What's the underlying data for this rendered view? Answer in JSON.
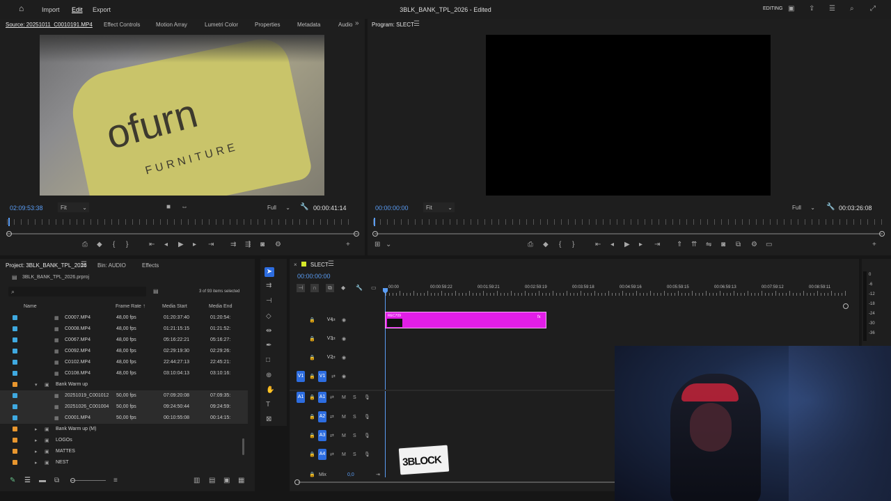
{
  "topbar": {
    "menu": [
      "Import",
      "Edit",
      "Export"
    ],
    "title": "3BLK_BANK_TPL_2026 - Edited",
    "workspace": "EDITING"
  },
  "source_panel": {
    "tabs": [
      "Source: 20251011_C0010191.MP4",
      "Effect Controls",
      "Motion Array",
      "Lumetri Color",
      "Properties",
      "Metadata",
      "Audio"
    ],
    "timecode": "02:09:53:38",
    "fit": "Fit",
    "quality": "Full",
    "duration": "00:00:41:14",
    "video_text": "ofurn",
    "video_subtext": "FURNITURE"
  },
  "program_panel": {
    "title": "Program: SLECT",
    "timecode": "00:00:00:00",
    "fit": "Fit",
    "quality": "Full",
    "duration": "00:03:26:08"
  },
  "project_panel": {
    "tabs": [
      "Project: 3BLK_BANK_TPL_2026",
      "Bin: AUDIO",
      "Effects"
    ],
    "project_file": "3BLK_BANK_TPL_2026.prproj",
    "selection": "3 of 93 items selected",
    "columns": [
      "Name",
      "Frame Rate",
      "Media Start",
      "Media End"
    ],
    "rows": [
      {
        "name": "C0007.MP4",
        "fps": "48,00 fps",
        "start": "01:20:37:40",
        "end": "01:20:54:",
        "color": "#3fa9e0",
        "selected": false
      },
      {
        "name": "C0008.MP4",
        "fps": "48,00 fps",
        "start": "01:21:15:15",
        "end": "01:21:52:",
        "color": "#3fa9e0",
        "selected": false
      },
      {
        "name": "C0067.MP4",
        "fps": "48,00 fps",
        "start": "05:16:22:21",
        "end": "05:16:27:",
        "color": "#3fa9e0",
        "selected": false
      },
      {
        "name": "C0092.MP4",
        "fps": "48,00 fps",
        "start": "02:29:19:30",
        "end": "02:29:26:",
        "color": "#3fa9e0",
        "selected": false
      },
      {
        "name": "C0102.MP4",
        "fps": "48,00 fps",
        "start": "22:44:27:13",
        "end": "22:45:21:",
        "color": "#3fa9e0",
        "selected": false
      },
      {
        "name": "C0108.MP4",
        "fps": "48,00 fps",
        "start": "03:10:04:13",
        "end": "03:10:16:",
        "color": "#3fa9e0",
        "selected": false
      },
      {
        "name": "Bank Warm up",
        "fps": "",
        "start": "",
        "end": "",
        "color": "#e8962e",
        "selected": false,
        "folder": true
      },
      {
        "name": "20251019_C001012",
        "fps": "50,00 fps",
        "start": "07:09:20:08",
        "end": "07:09:35:",
        "color": "#3fa9e0",
        "selected": true
      },
      {
        "name": "20251026_C001004",
        "fps": "50,00 fps",
        "start": "09:24:50:44",
        "end": "09:24:59:",
        "color": "#3fa9e0",
        "selected": true
      },
      {
        "name": "C0001.MP4",
        "fps": "50,00 fps",
        "start": "00:10:55:08",
        "end": "00:14:15:",
        "color": "#3fa9e0",
        "selected": true
      },
      {
        "name": "Bank Warm up (M)",
        "fps": "",
        "start": "",
        "end": "",
        "color": "#e8962e",
        "selected": false,
        "folder": true
      },
      {
        "name": "LOGOs",
        "fps": "",
        "start": "",
        "end": "",
        "color": "#e8962e",
        "selected": false,
        "folder": true
      },
      {
        "name": "MATTES",
        "fps": "",
        "start": "",
        "end": "",
        "color": "#e8962e",
        "selected": false,
        "folder": true
      },
      {
        "name": "NEST",
        "fps": "",
        "start": "",
        "end": "",
        "color": "#e8962e",
        "selected": false,
        "folder": true
      }
    ]
  },
  "timeline": {
    "title": "SLECT",
    "timecode": "00:00:00:00",
    "ruler": [
      "00:00",
      "00:00:59:22",
      "00:01:59:21",
      "00:02:59:19",
      "00:03:59:18",
      "00:04:59:16",
      "00:05:59:15",
      "00:06:59:13",
      "00:07:59:12",
      "00:08:59:11"
    ],
    "tracks": [
      "V4",
      "V3",
      "V2",
      "V1",
      "A1",
      "A2",
      "A3",
      "A4"
    ],
    "mix_label": "Mix",
    "mix_value": "0,0",
    "clip_label": "REC709",
    "clip_color": "#e21ee8",
    "meter_labels": [
      "0",
      "-6",
      "-12",
      "-18",
      "-24",
      "-30",
      "-36"
    ],
    "sticker_text": "3BLOCK"
  }
}
